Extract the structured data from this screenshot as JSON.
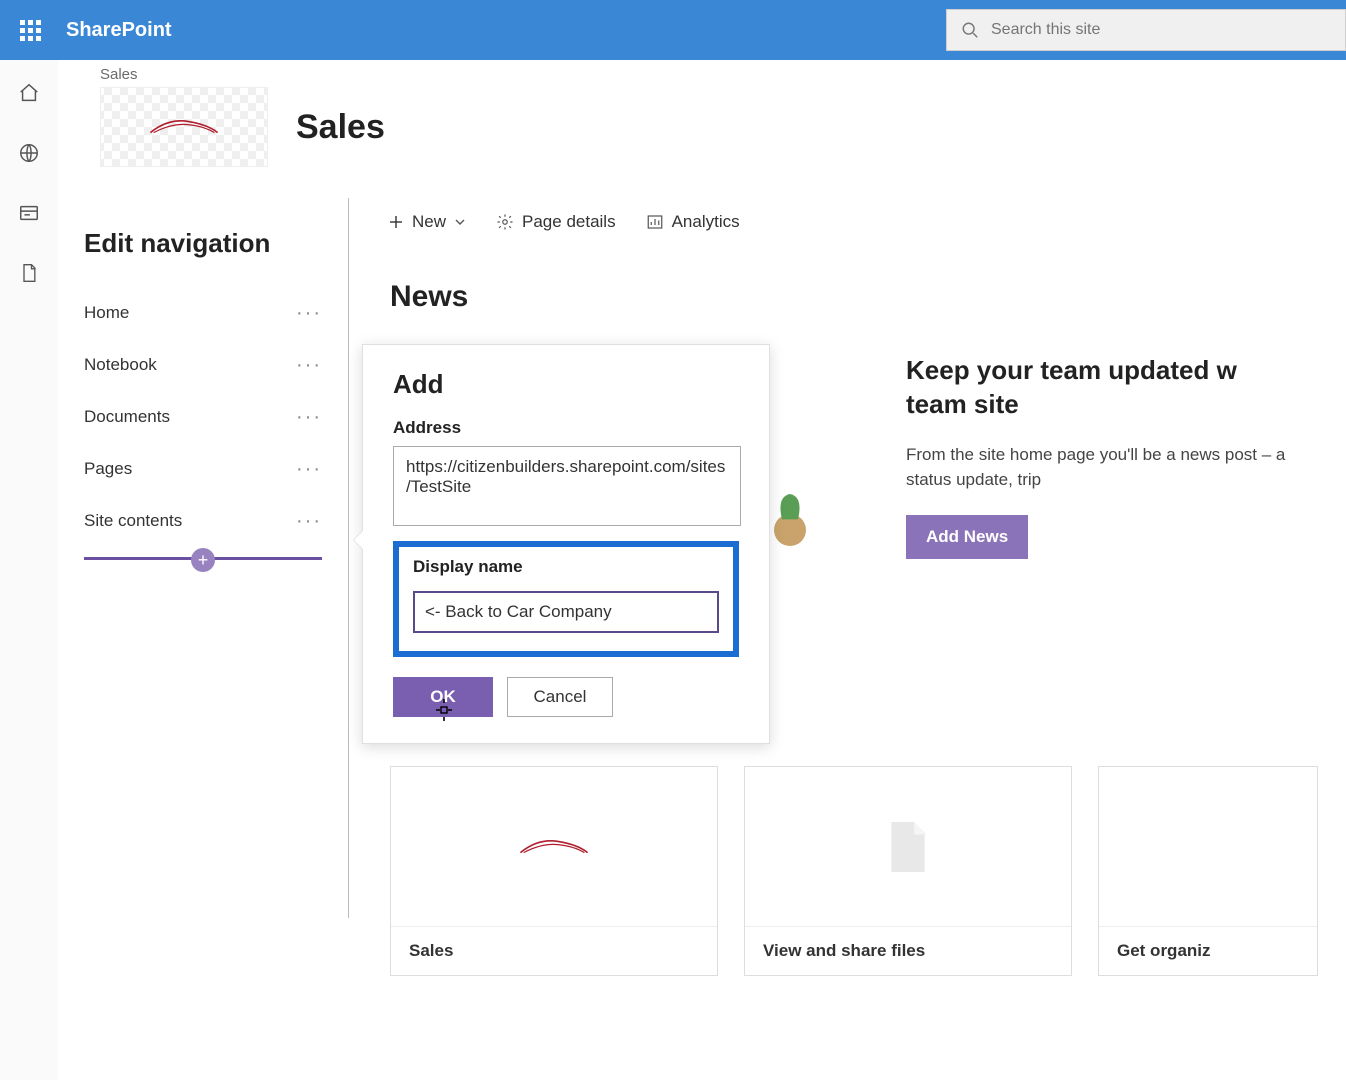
{
  "suite": {
    "brand": "SharePoint",
    "search_placeholder": "Search this site"
  },
  "breadcrumb": "Sales",
  "page_title": "Sales",
  "edit_nav": {
    "title": "Edit navigation",
    "items": [
      {
        "label": "Home"
      },
      {
        "label": "Notebook"
      },
      {
        "label": "Documents"
      },
      {
        "label": "Pages"
      },
      {
        "label": "Site contents"
      }
    ]
  },
  "cmdbar": {
    "new": "New",
    "page_details": "Page details",
    "analytics": "Analytics"
  },
  "news": {
    "heading": "News",
    "promo_title": "Keep your team updated w",
    "promo_title2": "team site",
    "promo_body": "From the site home page you'll be a news post – a status update, trip ",
    "add_button": "Add News"
  },
  "callout": {
    "title": "Add",
    "address_label": "Address",
    "address_value": "https://citizenbuilders.sharepoint.com/sites/TestSite",
    "display_label": "Display name",
    "display_value": "<- Back to Car Company",
    "ok": "OK",
    "cancel": "Cancel"
  },
  "cards": {
    "c1": "Sales",
    "c2": "View and share files",
    "c3": "Get organiz"
  }
}
